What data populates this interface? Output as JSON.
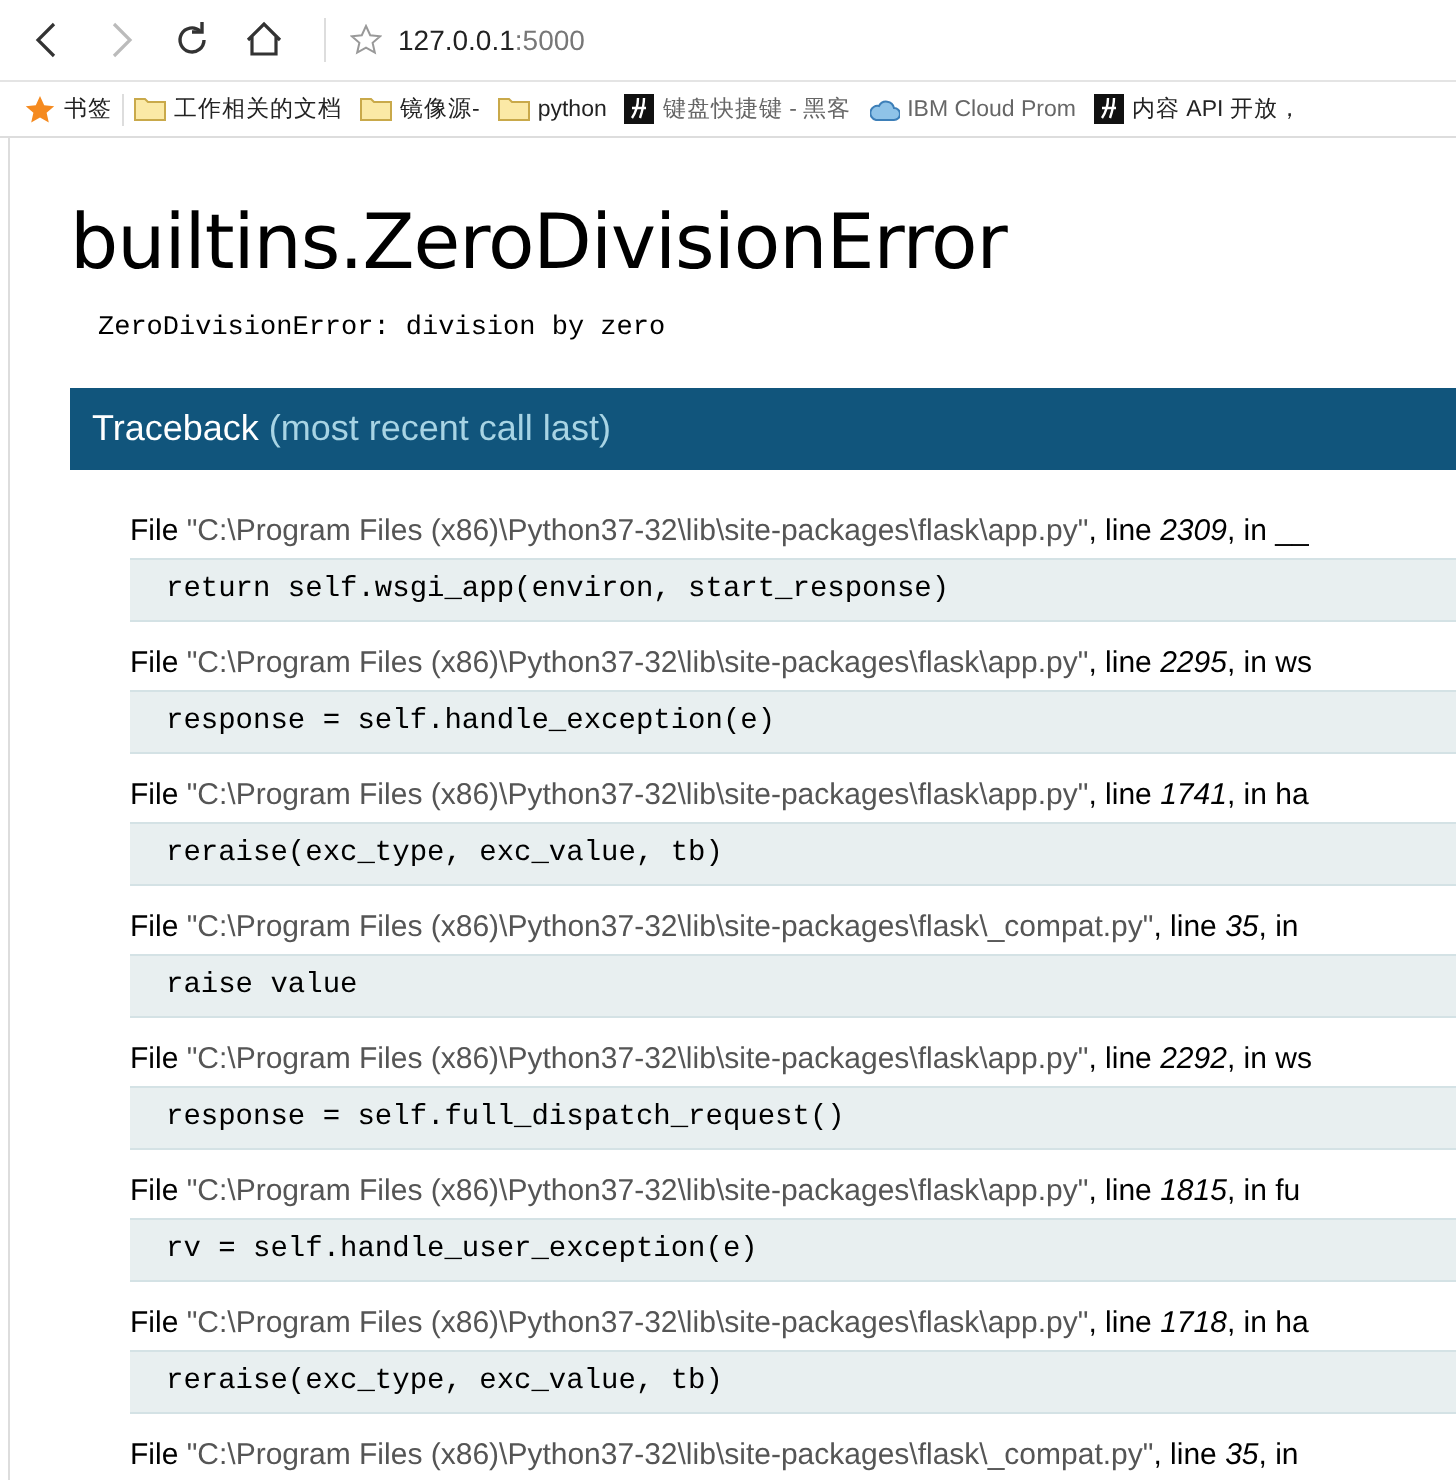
{
  "browser": {
    "address": {
      "host": "127.0.0.1",
      "port": ":5000"
    },
    "bookmarks": [
      {
        "kind": "star",
        "label": "书签",
        "faded": false
      },
      {
        "kind": "folder",
        "label": "工作相关的文档",
        "faded": false
      },
      {
        "kind": "folder",
        "label": "镜像源-",
        "faded": false
      },
      {
        "kind": "folder",
        "label": "python",
        "faded": false
      },
      {
        "kind": "site-h",
        "label": "键盘快捷键 - 黑客",
        "faded": true
      },
      {
        "kind": "site-cloud",
        "label": "IBM Cloud Prom",
        "faded": true
      },
      {
        "kind": "site-h",
        "label": "内容 API 开放，",
        "faded": false
      }
    ]
  },
  "page": {
    "title": "builtins.ZeroDivisionError",
    "message": "ZeroDivisionError: division by zero",
    "traceback": {
      "title": "Traceback",
      "subtitle": "(most recent call last)",
      "frames": [
        {
          "file_label": "File",
          "file": "\"C:\\Program Files (x86)\\Python37-32\\lib\\site-packages\\flask\\app.py\"",
          "line_label": ", line",
          "line": "2309",
          "in_label": ", in",
          "function": "__",
          "code": "return self.wsgi_app(environ, start_response)"
        },
        {
          "file_label": "File",
          "file": "\"C:\\Program Files (x86)\\Python37-32\\lib\\site-packages\\flask\\app.py\"",
          "line_label": ", line",
          "line": "2295",
          "in_label": ", in",
          "function": "ws",
          "code": "response = self.handle_exception(e)"
        },
        {
          "file_label": "File",
          "file": "\"C:\\Program Files (x86)\\Python37-32\\lib\\site-packages\\flask\\app.py\"",
          "line_label": ", line",
          "line": "1741",
          "in_label": ", in",
          "function": "ha",
          "code": "reraise(exc_type, exc_value, tb)"
        },
        {
          "file_label": "File",
          "file": "\"C:\\Program Files (x86)\\Python37-32\\lib\\site-packages\\flask\\_compat.py\"",
          "line_label": ", line",
          "line": "35",
          "in_label": ", in",
          "code": "raise value"
        },
        {
          "file_label": "File",
          "file": "\"C:\\Program Files (x86)\\Python37-32\\lib\\site-packages\\flask\\app.py\"",
          "line_label": ", line",
          "line": "2292",
          "in_label": ", in",
          "function": "ws",
          "code": "response = self.full_dispatch_request()"
        },
        {
          "file_label": "File",
          "file": "\"C:\\Program Files (x86)\\Python37-32\\lib\\site-packages\\flask\\app.py\"",
          "line_label": ", line",
          "line": "1815",
          "in_label": ", in",
          "function": "fu",
          "code": "rv = self.handle_user_exception(e)"
        },
        {
          "file_label": "File",
          "file": "\"C:\\Program Files (x86)\\Python37-32\\lib\\site-packages\\flask\\app.py\"",
          "line_label": ", line",
          "line": "1718",
          "in_label": ", in",
          "function": "ha",
          "code": "reraise(exc_type, exc_value, tb)"
        },
        {
          "file_label": "File",
          "file": "\"C:\\Program Files (x86)\\Python37-32\\lib\\site-packages\\flask\\_compat.py\"",
          "line_label": ", line",
          "line": "35",
          "in_label": ", in"
        }
      ]
    }
  }
}
